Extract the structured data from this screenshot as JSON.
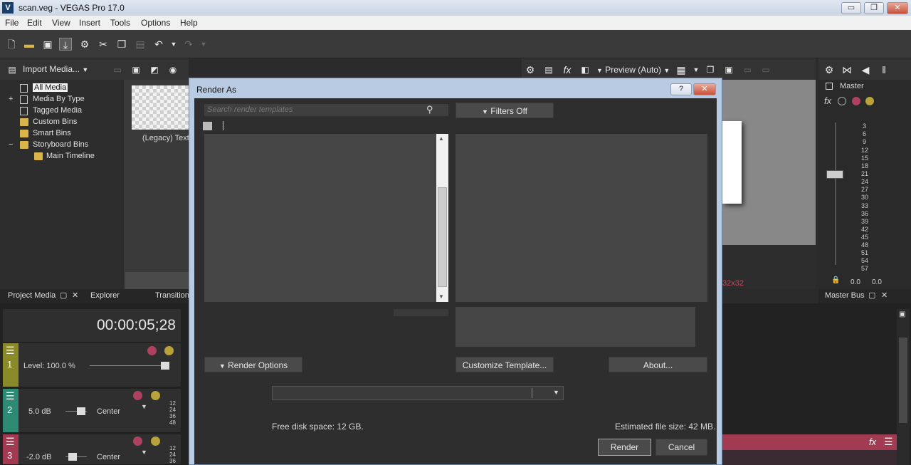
{
  "window": {
    "title": "scan.veg - VEGAS Pro 17.0",
    "logo": "V",
    "minimize": "▭",
    "restore": "❐",
    "close": "✕"
  },
  "menu": [
    "File",
    "Edit",
    "View",
    "Insert",
    "Tools",
    "Options",
    "Help"
  ],
  "toolbar_icons": [
    "new-file-icon",
    "open-folder-icon",
    "save-icon",
    "render-as-icon",
    "properties-gear-icon",
    "cut-icon",
    "copy-icon",
    "paste-icon",
    "undo-icon",
    "undo-dropdown-icon",
    "redo-icon",
    "redo-dropdown-icon"
  ],
  "project_media": {
    "import_label": "Import Media...",
    "tree": [
      {
        "label": "All Media"
      },
      {
        "label": "Media By Type",
        "expand": "+"
      },
      {
        "label": "Tagged Media"
      },
      {
        "label": "Custom Bins"
      },
      {
        "label": "Smart Bins"
      },
      {
        "label": "Storyboard Bins",
        "expand": "−"
      },
      {
        "label": "Main Timeline"
      }
    ],
    "thumb_caption": "(Legacy) Text",
    "tabs": [
      "Project Media",
      "Explorer",
      "Transition"
    ]
  },
  "preview": {
    "quality": "Preview (Auto)",
    "size_text": "32x32"
  },
  "master": {
    "label": "Master",
    "scale": [
      "3",
      "6",
      "9",
      "12",
      "15",
      "18",
      "21",
      "24",
      "27",
      "30",
      "33",
      "36",
      "39",
      "42",
      "45",
      "48",
      "51",
      "54",
      "57"
    ],
    "left_value": "0.0",
    "right_value": "0.0",
    "tab": "Master Bus"
  },
  "timeline": {
    "timecode": "00:00:05;28",
    "tracks": [
      {
        "number": "1",
        "level": "Level: 100.0 %",
        "color": "#8a8a2a"
      },
      {
        "number": "2",
        "volume": "5.0 dB",
        "pan": "Center",
        "color": "#2e8a74"
      },
      {
        "number": "3",
        "volume": "-2.0 dB",
        "pan": "Center",
        "color": "#a23a52"
      }
    ],
    "ruler_marks": [
      "12",
      "24",
      "36",
      "48"
    ]
  },
  "dialog": {
    "title": "Render As",
    "help_button": "?",
    "close_button": "✕",
    "search_placeholder": "Search render templates",
    "filters_label": "Filters Off",
    "render_options_label": "Render Options",
    "customize_label": "Customize Template...",
    "about_label": "About...",
    "free_disk": "Free disk space: 12 GB.",
    "estimated_size": "Estimated file size: 42 MB.",
    "render_button": "Render",
    "cancel_button": "Cancel"
  }
}
